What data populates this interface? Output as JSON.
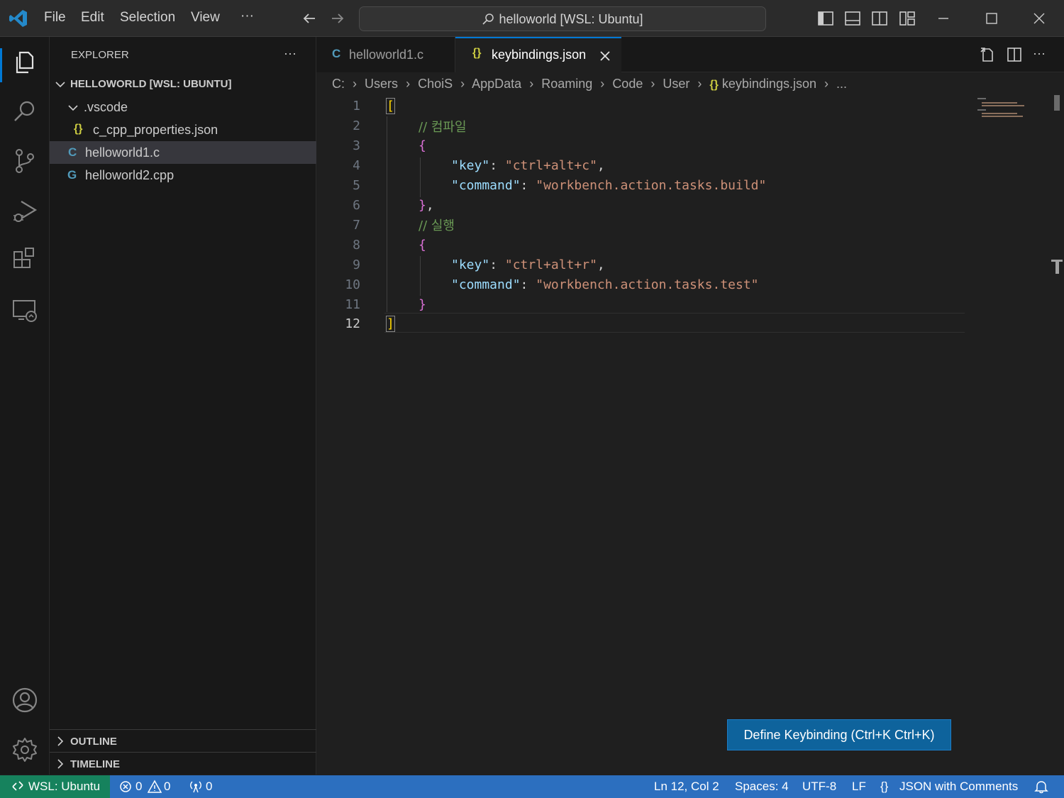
{
  "titlebar": {
    "menus": [
      "File",
      "Edit",
      "Selection",
      "View",
      "···"
    ],
    "search_text": "helloworld [WSL: Ubuntu]"
  },
  "sidebar": {
    "title": "EXPLORER",
    "more": "···",
    "root": "HELLOWORLD [WSL: UBUNTU]",
    "folder": ".vscode",
    "files": [
      {
        "name": "c_cpp_properties.json",
        "icon": "{}"
      },
      {
        "name": "helloworld1.c",
        "icon": "C"
      },
      {
        "name": "helloworld2.cpp",
        "icon": "G"
      }
    ],
    "outline": "OUTLINE",
    "timeline": "TIMELINE"
  },
  "tabs": [
    {
      "label": "helloworld1.c",
      "icon": "C"
    },
    {
      "label": "keybindings.json",
      "icon": "{}"
    }
  ],
  "breadcrumb": [
    "C:",
    "Users",
    "ChoiS",
    "AppData",
    "Roaming",
    "Code",
    "User",
    "keybindings.json",
    "..."
  ],
  "editor": {
    "line_numbers": [
      "1",
      "2",
      "3",
      "4",
      "5",
      "6",
      "7",
      "8",
      "9",
      "10",
      "11",
      "12"
    ],
    "comment1": "// 컴파일",
    "comment2": "// 실행",
    "key_label": "\"key\"",
    "command_label": "\"command\"",
    "key1": "\"ctrl+alt+c\"",
    "command1": "\"workbench.action.tasks.build\"",
    "key2": "\"ctrl+alt+r\"",
    "command2": "\"workbench.action.tasks.test\""
  },
  "define_button": "Define Keybinding (Ctrl+K Ctrl+K)",
  "statusbar": {
    "remote": "WSL: Ubuntu",
    "errors": "0",
    "warnings": "0",
    "ports": "0",
    "position": "Ln 12, Col 2",
    "spaces": "Spaces: 4",
    "encoding": "UTF-8",
    "eol": "LF",
    "language": "JSON with Comments"
  },
  "colors": {
    "accent": "#2c6fbf",
    "remote": "#16825d"
  }
}
